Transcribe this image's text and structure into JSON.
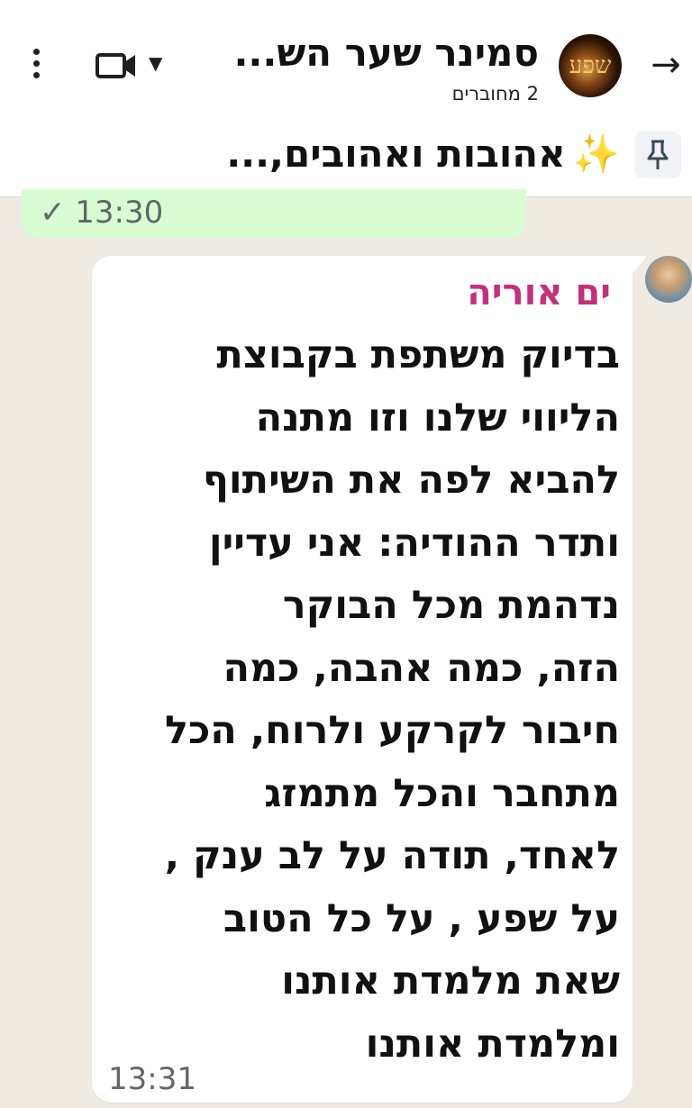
{
  "header": {
    "title": "סמינר שער הש...",
    "subtitle": "2 מחוברים",
    "avatar_text": "שפע"
  },
  "pinned": {
    "icon": "pin-icon",
    "sparkle": "✨",
    "text": "אהובות ואהובים,..."
  },
  "previous_message": {
    "time": "✓ 13:30"
  },
  "message": {
    "sender": "ים אוריה",
    "lines": [
      "בדיוק משתפת בקבוצת",
      "הליווי שלנו וזו מתנה",
      "להביא לפה את השיתוף",
      "ותדר ההודיה: אני עדיין",
      "נדהמת מכל הבוקר",
      "הזה, כמה אהבה, כמה",
      "חיבור לקרקע ולרוח, הכל",
      "מתחבר והכל מתמזג",
      "לאחד, תודה על לב ענק ,",
      "על שפע , על כל הטוב",
      "שאת מלמדת אותנו",
      "ומלמדת אותנו"
    ],
    "time": "13:31"
  },
  "colors": {
    "sender_name": "#c6307a",
    "outgoing_bubble": "#d9fdd3",
    "chat_background": "#efeae2"
  }
}
